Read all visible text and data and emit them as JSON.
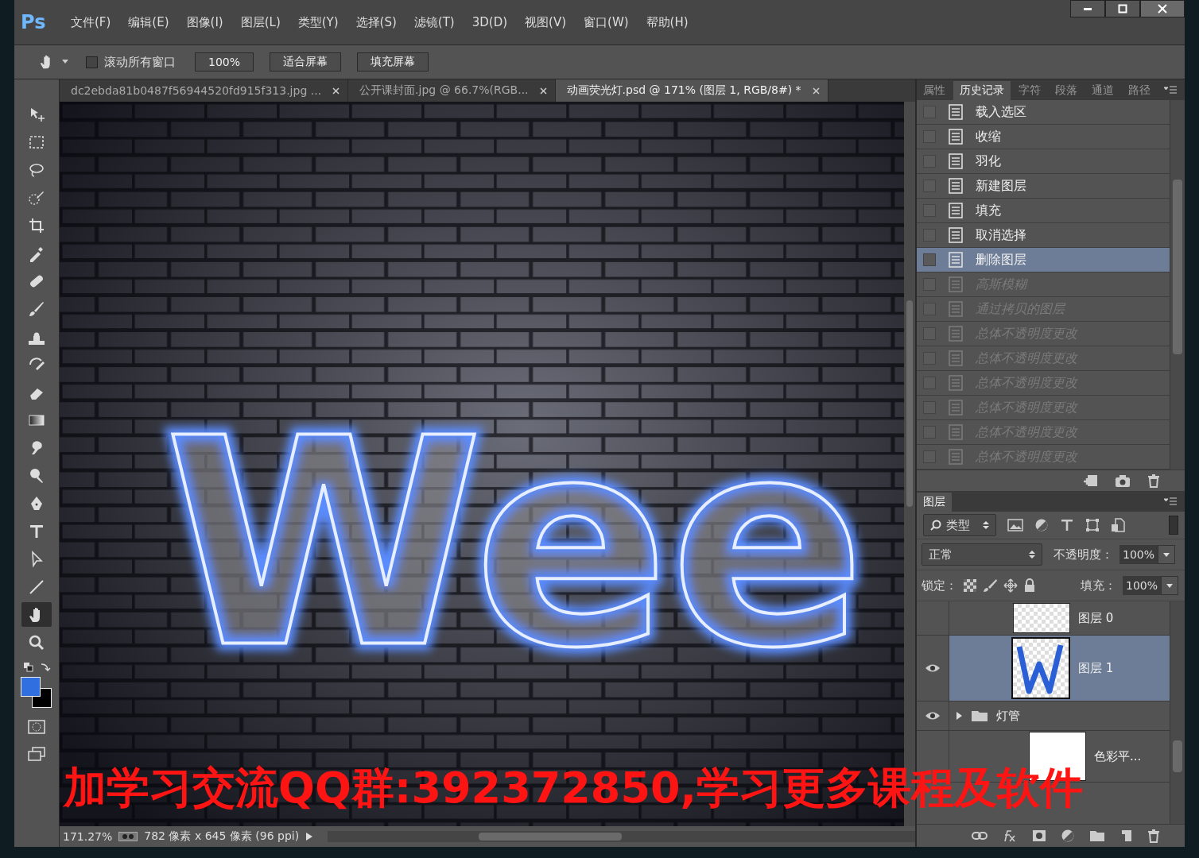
{
  "menu_bar": {
    "logo": "Ps",
    "items": [
      "文件(F)",
      "编辑(E)",
      "图像(I)",
      "图层(L)",
      "类型(Y)",
      "选择(S)",
      "滤镜(T)",
      "3D(D)",
      "视图(V)",
      "窗口(W)",
      "帮助(H)"
    ]
  },
  "options_bar": {
    "scroll_all": {
      "label": "滚动所有窗口",
      "checked": false
    },
    "buttons": [
      "100%",
      "适合屏幕",
      "填充屏幕"
    ]
  },
  "document_tabs": [
    {
      "label": "dc2ebda81b0487f56944520fd915f313.jpg ...",
      "selected": false
    },
    {
      "label": "公开课封面.jpg @ 66.7%(RGB...",
      "selected": false
    },
    {
      "label": "动画荧光灯.psd @ 171% (图层 1, RGB/8#) *",
      "selected": true
    }
  ],
  "tools": [
    {
      "kind": "move",
      "selected": false
    },
    {
      "kind": "marquee",
      "selected": false
    },
    {
      "kind": "lasso",
      "selected": false
    },
    {
      "kind": "quick-select",
      "selected": false
    },
    {
      "kind": "crop",
      "selected": false
    },
    {
      "kind": "eyedropper",
      "selected": false
    },
    {
      "kind": "healing",
      "selected": false
    },
    {
      "kind": "brush",
      "selected": false
    },
    {
      "kind": "stamp",
      "selected": false
    },
    {
      "kind": "history-brush",
      "selected": false
    },
    {
      "kind": "eraser",
      "selected": false
    },
    {
      "kind": "gradient",
      "selected": false
    },
    {
      "kind": "smudge",
      "selected": false
    },
    {
      "kind": "dodge",
      "selected": false
    },
    {
      "kind": "pen",
      "selected": false
    },
    {
      "kind": "type",
      "selected": false
    },
    {
      "kind": "path-select",
      "selected": false
    },
    {
      "kind": "line",
      "selected": false
    },
    {
      "kind": "hand",
      "selected": true
    },
    {
      "kind": "zoom",
      "selected": false
    }
  ],
  "canvas": {
    "artwork_text": "Wee"
  },
  "status_bar": {
    "zoom": "171.27%",
    "info": "782 像素 x 645 像素 (96 ppi)"
  },
  "history_panel": {
    "tabs": [
      {
        "label": "属性",
        "selected": false
      },
      {
        "label": "历史记录",
        "selected": true
      },
      {
        "label": "字符",
        "selected": false
      },
      {
        "label": "段落",
        "selected": false
      },
      {
        "label": "通道",
        "selected": false
      },
      {
        "label": "路径",
        "selected": false
      }
    ],
    "items": [
      {
        "label": "载入选区",
        "selected": false,
        "disabled": false
      },
      {
        "label": "收缩",
        "selected": false,
        "disabled": false
      },
      {
        "label": "羽化",
        "selected": false,
        "disabled": false
      },
      {
        "label": "新建图层",
        "selected": false,
        "disabled": false
      },
      {
        "label": "填充",
        "selected": false,
        "disabled": false
      },
      {
        "label": "取消选择",
        "selected": false,
        "disabled": false
      },
      {
        "label": "删除图层",
        "selected": true,
        "disabled": false
      },
      {
        "label": "高斯模糊",
        "selected": false,
        "disabled": true
      },
      {
        "label": "通过拷贝的图层",
        "selected": false,
        "disabled": true
      },
      {
        "label": "总体不透明度更改",
        "selected": false,
        "disabled": true
      },
      {
        "label": "总体不透明度更改",
        "selected": false,
        "disabled": true
      },
      {
        "label": "总体不透明度更改",
        "selected": false,
        "disabled": true
      },
      {
        "label": "总体不透明度更改",
        "selected": false,
        "disabled": true
      },
      {
        "label": "总体不透明度更改",
        "selected": false,
        "disabled": true
      },
      {
        "label": "总体不透明度更改",
        "selected": false,
        "disabled": true
      }
    ]
  },
  "layers_panel": {
    "title": "图层",
    "filter": "类型",
    "blend_mode": "正常",
    "opacity_label": "不透明度：",
    "opacity": "100%",
    "lock_label": "锁定：",
    "fill_label": "填充：",
    "fill": "100%",
    "layers": [
      {
        "name": "图层 0",
        "kind": "layer",
        "visible": false,
        "selected": false
      },
      {
        "name": "图层 1",
        "kind": "art-layer",
        "visible": true,
        "selected": true
      },
      {
        "name": "灯管",
        "kind": "group",
        "visible": true,
        "selected": false
      },
      {
        "name": "色彩平...",
        "kind": "adjustment",
        "visible": false,
        "selected": false
      }
    ]
  },
  "overlay_banner": "加学习交流QQ群:392372850,学习更多课程及软件"
}
